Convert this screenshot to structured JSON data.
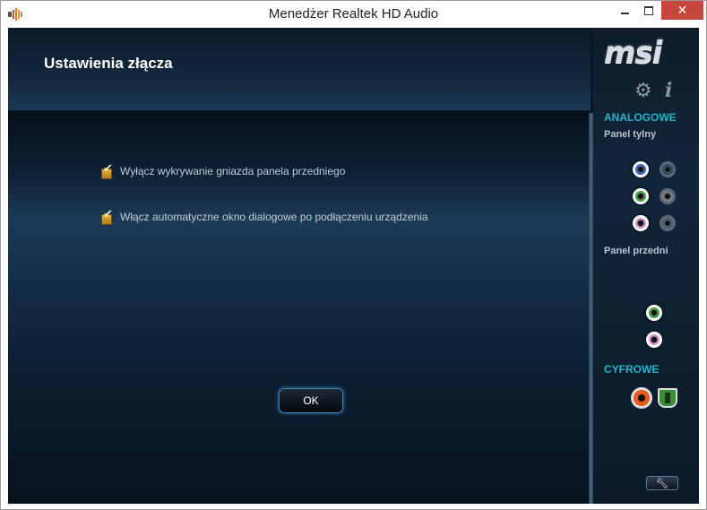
{
  "window": {
    "title": "Menedżer Realtek HD Audio",
    "close_glyph": "✕",
    "icons": {
      "app": "speaker-volume-icon",
      "minimize": "minimize-icon",
      "maximize": "maximize-icon",
      "close": "close-icon"
    }
  },
  "header": {
    "title": "Ustawienia złącza"
  },
  "options": [
    {
      "label": "Wyłącz wykrywanie gniazda panela przedniego",
      "checked": true
    },
    {
      "label": "Włącz automatyczne okno dialogowe po podłączeniu urządzenia",
      "checked": true
    }
  ],
  "ok_button": {
    "label": "OK"
  },
  "sidebar": {
    "brand": "msi",
    "analog_title": "ANALOGOWE",
    "rear_panel_label": "Panel tylny",
    "front_panel_label": "Panel przedni",
    "digital_title": "CYFROWE",
    "icons": {
      "settings": "gear-icon",
      "info": "info-icon",
      "advanced": "wrench-icon"
    },
    "rear_jacks": [
      {
        "color": "#2466c9",
        "active": true
      },
      {
        "color": "#2a4f7a",
        "active": false
      },
      {
        "color": "#3aa63a",
        "active": true
      },
      {
        "color": "#8b8f93",
        "active": false
      },
      {
        "color": "#e08fd8",
        "active": true
      },
      {
        "color": "#4a6a88",
        "active": false
      }
    ],
    "front_jacks": [
      {
        "color": "#3aa63a",
        "active": true
      },
      {
        "color": "#e08fd8",
        "active": true
      }
    ],
    "digital_ports": [
      {
        "type": "coaxial",
        "color": "#e85a1c"
      },
      {
        "type": "optical",
        "color": "#3e8b3a"
      }
    ]
  },
  "colors": {
    "accent": "#27b3c7",
    "checkbox": "#e6b53a",
    "close_button": "#c7463c"
  }
}
